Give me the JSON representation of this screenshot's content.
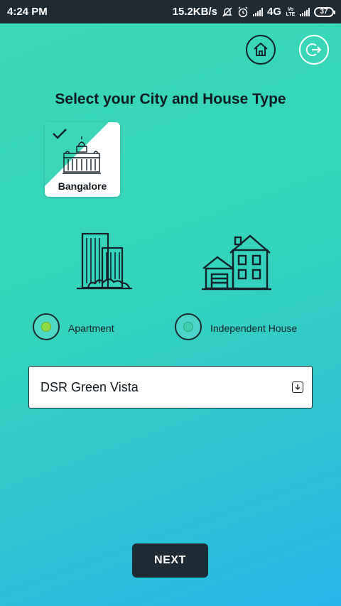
{
  "status_bar": {
    "time": "4:24 PM",
    "net_speed": "15.2KB/s",
    "network_type": "4G",
    "volte_label": "Vo LTE",
    "battery": "37",
    "icons": [
      "mute-bell-icon",
      "alarm-icon",
      "signal-icon",
      "signal-icon",
      "battery-icon"
    ]
  },
  "header": {
    "home_icon": "home-icon",
    "logout_icon": "logout-icon"
  },
  "title": "Select your City and House Type",
  "cities": [
    {
      "label": "Bangalore",
      "selected": true,
      "icon": "vidhana-soudha-icon"
    }
  ],
  "house_types": [
    {
      "label": "Apartment",
      "selected": true,
      "icon": "apartment-building-icon"
    },
    {
      "label": "Independent House",
      "selected": false,
      "icon": "independent-house-icon"
    }
  ],
  "project_select": {
    "value": "DSR Green Vista",
    "icon": "dropdown-arrow-icon"
  },
  "next_label": "NEXT",
  "colors": {
    "accent": "#3ad8b6",
    "radio_selected": "#8fdb45",
    "button_bg": "#1f2b34"
  }
}
